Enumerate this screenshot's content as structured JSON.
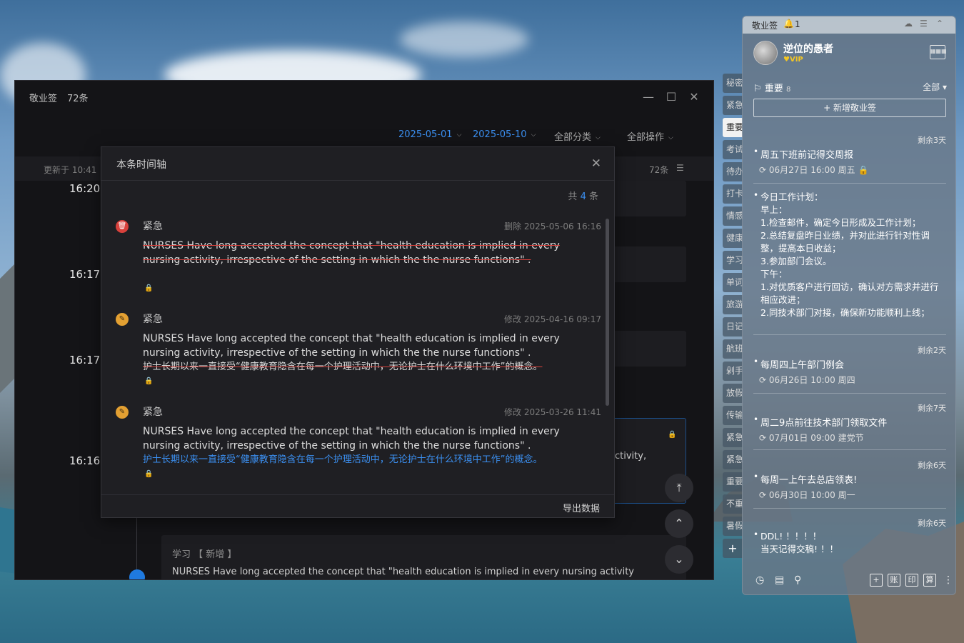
{
  "main": {
    "title": "敬业签",
    "count": "72条",
    "date_start": "2025-05-01",
    "date_end": "2025-05-10",
    "category_filter": "全部分类",
    "ops_menu": "全部操作",
    "updated": "更新于 10:41",
    "total_right": "72条",
    "times": [
      "16:20:",
      "16:17:",
      "16:17:",
      "16:16:"
    ],
    "bottom_card_label": "学习 【 新增 】",
    "bottom_card_text": "NURSES Have long accepted the concept that \"health education is implied in every nursing activity",
    "activity_fragment": "ctivity,"
  },
  "modal": {
    "title": "本条时间轴",
    "total_prefix": "共",
    "total_num": "4",
    "total_suffix": "条",
    "export": "导出数据",
    "entries": [
      {
        "category": "紧急",
        "meta": "删除 2025-05-06 16:16",
        "text": "NURSES Have long accepted the concept that \"health education is implied in every nursing activity, irrespective of the setting in which the the nurse functions\" ."
      },
      {
        "category": "紧急",
        "meta": "修改 2025-04-16 09:17",
        "text": "NURSES Have long accepted the concept that \"health education is implied in every nursing activity, irrespective of the setting in which the the nurse functions\" .",
        "cn": "护士长期以来一直接受“健康教育隐含在每一个护理活动中，无论护士在什么环境中工作”的概念。"
      },
      {
        "category": "紧急",
        "meta": "修改 2025-03-26 11:41",
        "text": "NURSES Have long accepted the concept that \"health education is implied in every nursing activity, irrespective of the setting in which the the nurse functions\" .",
        "cn": "护士长期以来一直接受“健康教育隐含在每一个护理活动中，无论护士在什么环境中工作”的概念。"
      }
    ]
  },
  "tabs": [
    "秘密",
    "紧急",
    "重要",
    "考试",
    "待办",
    "打卡",
    "情感",
    "健康",
    "学习",
    "单词",
    "旅游",
    "日记",
    "航班",
    "剁手",
    "放假",
    "传输",
    "紧急",
    "紧急",
    "重要",
    "不重",
    "暑假"
  ],
  "widget": {
    "app_name": "敬业签",
    "bell_count": "1",
    "username": "逆位的愚者",
    "vip": "VIP",
    "section": "重要",
    "section_count": "8",
    "filter": "全部",
    "new_button": "+ 新增敬业签",
    "notes": [
      {
        "remain": "剩余3天",
        "title": "周五下班前记得交周报",
        "time": "06月27日 16:00 周五"
      },
      {
        "remain": "",
        "body": [
          "今日工作计划：",
          "早上：",
          "1.检查邮件，确定今日形成及工作计划；",
          "2.总结复盘昨日业绩，并对此进行针对性调整，提高本日收益；",
          "3.参加部门会议。",
          "下午：",
          "1.对优质客户进行回访，确认对方需求并进行相应改进；",
          "2.同技术部门对接，确保新功能顺利上线；"
        ]
      },
      {
        "remain": "剩余2天",
        "title": "每周四上午部门例会",
        "time": "06月26日 10:00 周四"
      },
      {
        "remain": "剩余7天",
        "title": "周二9点前往技术部门领取文件",
        "time": "07月01日 09:00 建党节"
      },
      {
        "remain": "剩余6天",
        "title": "每周一上午去总店领表!",
        "time": "06月30日 10:00 周一"
      },
      {
        "remain": "剩余6天",
        "body": [
          "DDL! ！！！！",
          "当天记得交稿! ！！"
        ]
      }
    ],
    "bottom_boxes": [
      "+",
      "账",
      "印",
      "算"
    ]
  }
}
